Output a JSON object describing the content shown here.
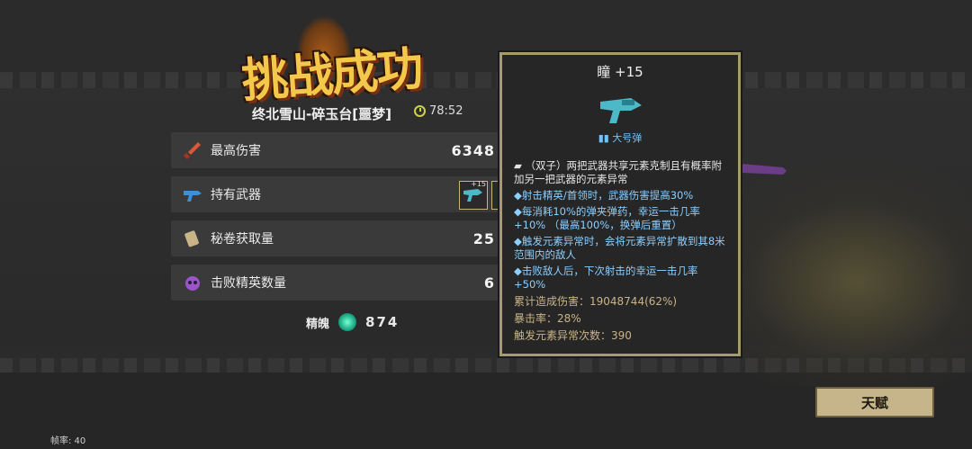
{
  "title": "挑战成功",
  "level": {
    "name": "终北雪山-碎玉台[噩梦]",
    "time": "78:52"
  },
  "stats": [
    {
      "label": "最高伤害",
      "value": "6348",
      "icon": "sword-damage-icon"
    },
    {
      "label": "持有武器",
      "value": "",
      "icon": "gun-icon"
    },
    {
      "label": "秘卷获取量",
      "value": "25",
      "icon": "scroll-icon"
    },
    {
      "label": "击败精英数量",
      "value": "6",
      "icon": "purple-skull-icon"
    }
  ],
  "weapon_slot_level": "+15",
  "soul": {
    "label": "精魄",
    "value": "874"
  },
  "tooltip": {
    "title": "瞳 +15",
    "ammo": "大号弹",
    "desc": "（双子）两把武器共享元素克制且有概率附加另一把武器的元素异常",
    "bullets": [
      "◆射击精英/首领时，武器伤害提高30%",
      "◆每消耗10%的弹夹弹药，幸运一击几率+10% （最高100%，换弹后重置）",
      "◆触发元素异常时，会将元素异常扩散到其8米范围内的敌人",
      "◆击败敌人后，下次射击的幸运一击几率+50%"
    ],
    "stats": [
      "累计造成伤害：19048744(62%)",
      "暴击率：28%",
      "触发元素异常次数：390"
    ]
  },
  "talent_button": "天赋",
  "fps": "帧率: 40",
  "colors": {
    "gold": "#f4c84a",
    "blue_text": "#8ccfff",
    "button": "#c6b48a"
  }
}
